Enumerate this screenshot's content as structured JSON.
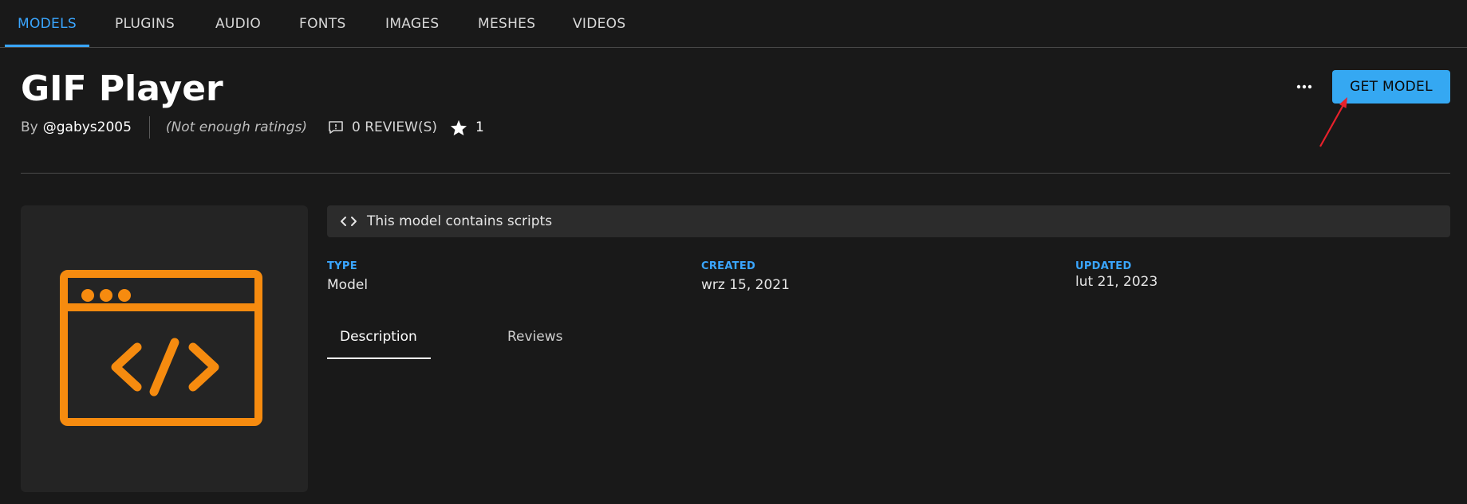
{
  "nav": {
    "tabs": [
      {
        "label": "MODELS",
        "active": true
      },
      {
        "label": "PLUGINS",
        "active": false
      },
      {
        "label": "AUDIO",
        "active": false
      },
      {
        "label": "FONTS",
        "active": false
      },
      {
        "label": "IMAGES",
        "active": false
      },
      {
        "label": "MESHES",
        "active": false
      },
      {
        "label": "VIDEOS",
        "active": false
      }
    ]
  },
  "asset": {
    "title": "GIF Player",
    "by_label": "By",
    "creator": "@gabys2005",
    "rating_text": "(Not enough ratings)",
    "reviews_text": "0 REVIEW(S)",
    "favorites": "1",
    "get_button_label": "GET MODEL",
    "script_notice": "This model contains scripts"
  },
  "details": {
    "type_label": "TYPE",
    "type_value": "Model",
    "created_label": "CREATED",
    "created_value": "wrz 15, 2021",
    "updated_label": "UPDATED",
    "updated_value": "lut 21, 2023"
  },
  "content_tabs": {
    "description": "Description",
    "reviews": "Reviews"
  },
  "icons": {
    "more": "more-horizontal-icon",
    "review": "comment-icon",
    "star": "star-icon",
    "code": "code-brackets-icon",
    "thumbnail": "script-window-icon"
  },
  "colors": {
    "background": "#191919",
    "accent_blue": "#3aa6ff",
    "button_blue": "#35a8f2",
    "thumbnail_orange": "#f68b0f",
    "annotation_red": "#e8212b"
  }
}
